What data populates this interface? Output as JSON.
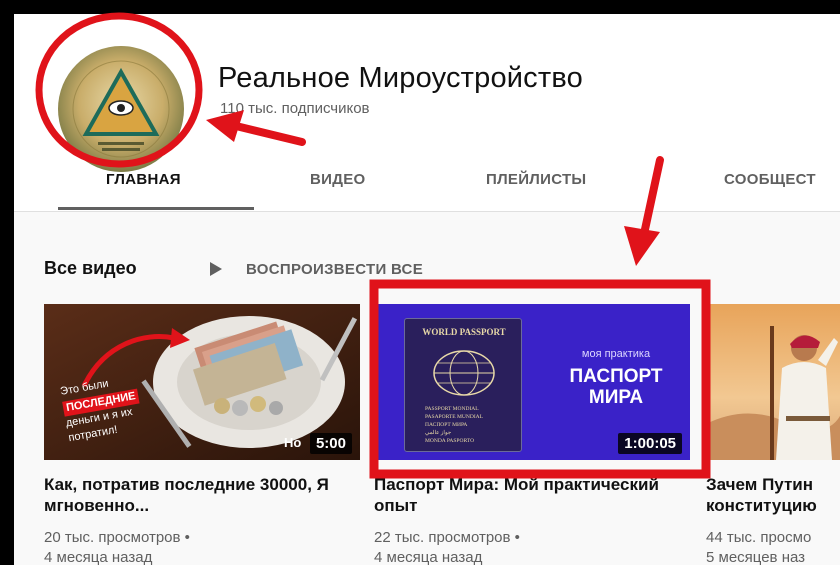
{
  "colors": {
    "annotation": "#e0131a",
    "text_primary": "#111111",
    "text_secondary": "#606060",
    "passport_bg": "#3a22c8"
  },
  "channel": {
    "name": "Реальное Мироустройство",
    "subscribers": "110 тыс. подписчиков",
    "avatar_icon": "all-seeing-eye-pyramid-icon"
  },
  "tabs": [
    {
      "label": "ГЛАВНАЯ",
      "active": true
    },
    {
      "label": "ВИДЕО"
    },
    {
      "label": "ПЛЕЙЛИСТЫ"
    },
    {
      "label": "СООБЩЕСТ"
    }
  ],
  "section": {
    "title": "Все видео",
    "play_all": "ВОСПРОИЗВЕСТИ ВСЕ",
    "play_icon": "play-icon"
  },
  "videos": [
    {
      "title": "Как, потратив последние 30000, Я мгновенно...",
      "views": "20 тыс. просмотров •",
      "age": "4 месяца назад",
      "duration": "5:00",
      "thumb_text": [
        "Это были",
        "ПОСЛЕДНИЕ",
        "деньги и я их",
        "потратил!"
      ],
      "thumb_corner": "Но"
    },
    {
      "title": "Паспорт Мира: Мой практический опыт",
      "views": "22 тыс. просмотров •",
      "age": "4 месяца назад",
      "duration": "1:00:05",
      "thumb_small": "моя практика",
      "thumb_big": [
        "ПАСПОРТ",
        "МИРА"
      ],
      "passport_cover": "WORLD PASSPORT",
      "passport_lines": [
        "PASSPORT MONDIAL",
        "PASAPORTE MUNDIAL",
        "ПАСПОРТ МИРА",
        "جواز عالمي",
        "MONDA PASPORTO"
      ]
    },
    {
      "title": "Зачем Путин конституцию",
      "views": "44 тыс. просмо",
      "age": "5 месяцев наз"
    }
  ]
}
